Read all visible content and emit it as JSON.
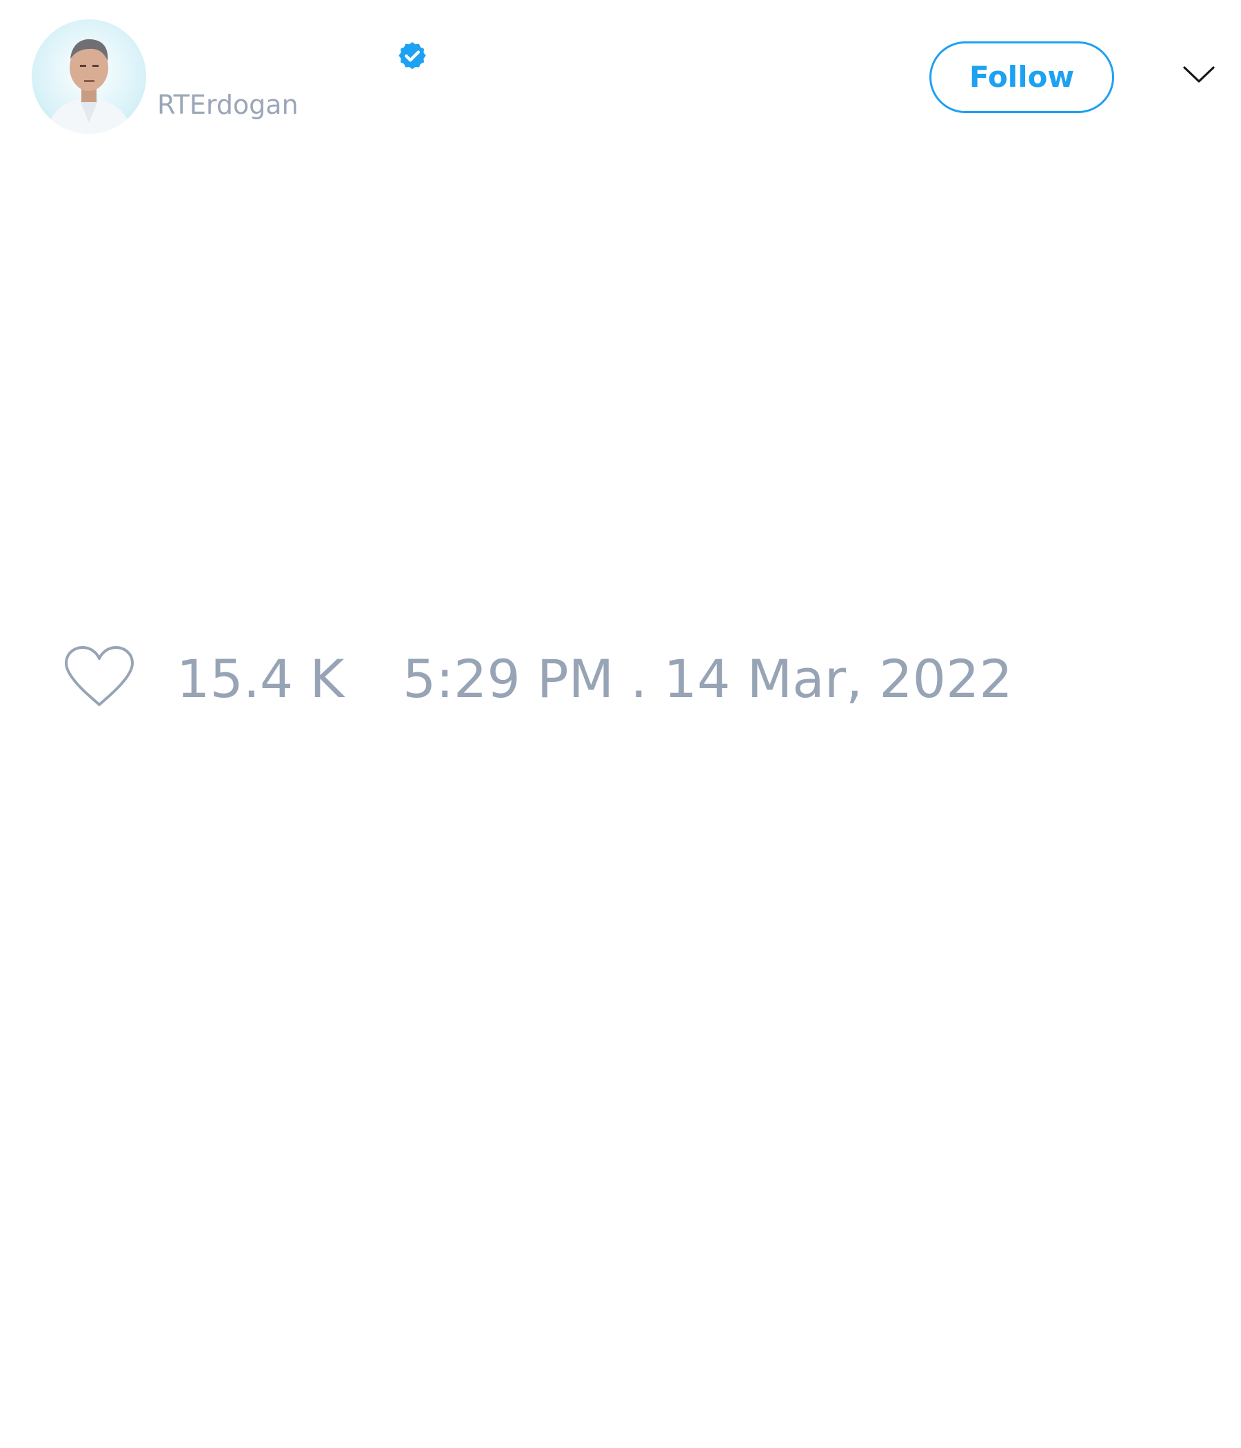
{
  "user": {
    "display_name": "",
    "handle": "RTErdogan",
    "verified": true
  },
  "header": {
    "follow_label": "Follow",
    "menu_icon": "chevron-down-icon"
  },
  "tweet": {
    "text": "",
    "like_icon": "heart-icon",
    "likes": "15.4 K",
    "timestamp": "5:29 PM . 14 Mar, 2022"
  },
  "colors": {
    "accent": "#1da1f2",
    "muted_text": "#97a4b6",
    "background": "#ffffff"
  }
}
